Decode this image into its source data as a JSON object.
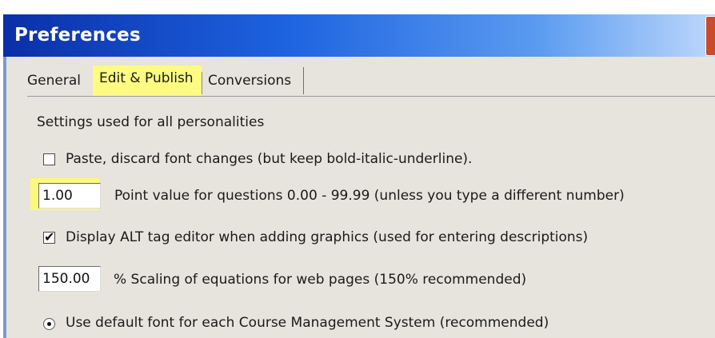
{
  "window": {
    "title": "Preferences"
  },
  "tabs": [
    {
      "label": "General",
      "active": false
    },
    {
      "label": "Edit & Publish",
      "active": true
    },
    {
      "label": "Conversions",
      "active": false
    }
  ],
  "settings": {
    "section_label": "Settings used for all personalities",
    "paste_option": {
      "label": "Paste, discard font changes (but keep bold-italic-underline).",
      "checked": false
    },
    "point_value": {
      "value": "1.00",
      "label": "Point value for questions 0.00 - 99.99  (unless you type a different number)"
    },
    "alt_tag": {
      "label": "Display ALT tag editor when adding graphics (used for entering descriptions)",
      "checked": true
    },
    "scaling": {
      "value": "150.00",
      "label": "%  Scaling of equations for web pages (150% recommended)"
    },
    "default_font": {
      "label": "Use default font for each Course Management System (recommended)",
      "selected": true
    }
  },
  "colors": {
    "highlight": "#fcf87a",
    "title_gradient_start": "#0a2fa8",
    "panel": "#e6e4dc"
  }
}
